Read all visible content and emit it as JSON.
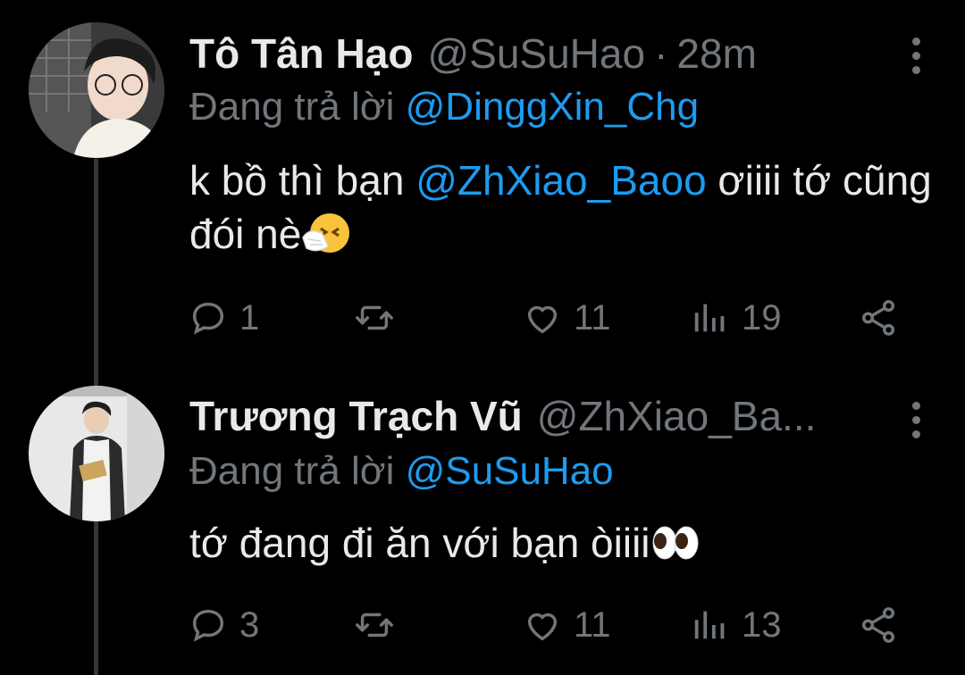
{
  "tweets": [
    {
      "display_name": "Tô Tân Hạo",
      "handle": "@SuSuHao",
      "separator": "·",
      "time": "28m",
      "reply_prefix": "Đang trả lời ",
      "reply_to": "@DinggXin_Chg",
      "body_before": "k bồ thì bạn ",
      "body_mention": "@ZhXiao_Baoo",
      "body_after": " ơiiii tớ cũng đói nè",
      "emoji": "sneezing-face",
      "replies": "1",
      "retweets": "",
      "likes": "11",
      "views": "19"
    },
    {
      "display_name": "Trương Trạch Vũ",
      "handle": "@ZhXiao_Ba...",
      "reply_prefix": "Đang trả lời ",
      "reply_to": "@SuSuHao",
      "body": "tớ đang đi ăn với bạn òiiii",
      "emoji": "eyes",
      "replies": "3",
      "retweets": "",
      "likes": "11",
      "views": "13"
    }
  ],
  "colors": {
    "background": "#000000",
    "text": "#e7e9ea",
    "secondary": "#71767b",
    "link": "#1d9bf0",
    "thread_line": "#333639"
  }
}
